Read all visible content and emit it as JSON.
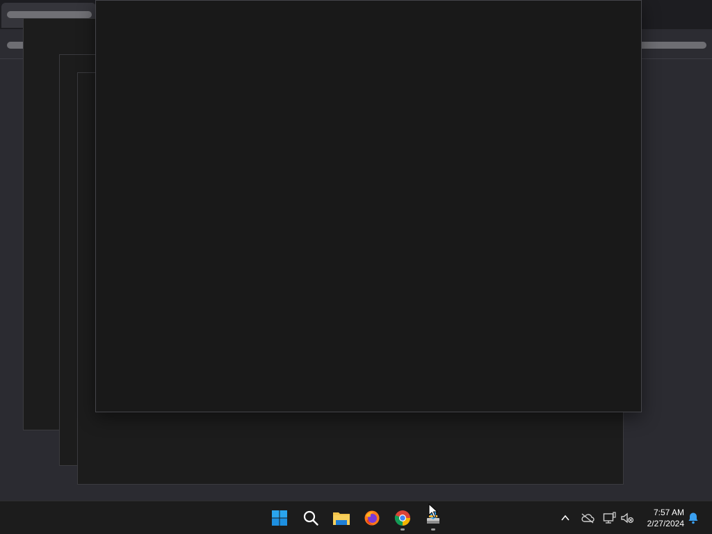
{
  "taskbar": {
    "apps": [
      {
        "name": "start-button",
        "icon": "windows-logo-icon"
      },
      {
        "name": "search-button",
        "icon": "search-icon"
      },
      {
        "name": "file-explorer-button",
        "icon": "folder-icon"
      },
      {
        "name": "firefox-button",
        "icon": "firefox-icon"
      },
      {
        "name": "chrome-button",
        "icon": "chrome-icon",
        "running": true
      },
      {
        "name": "installer-button",
        "icon": "installer-icon",
        "running": true
      }
    ],
    "tray": {
      "chevron": "chevron-up-icon",
      "onedrive": "cloud-offline-icon",
      "network": "network-icon",
      "volume": "volume-muted-icon",
      "notifications": "bell-icon"
    },
    "clock": {
      "time": "7:57 AM",
      "date": "2/27/2024"
    }
  },
  "colors": {
    "accent": "#0078d4",
    "taskbar_bg": "#1c1c1c",
    "window_bg": "#191919"
  }
}
